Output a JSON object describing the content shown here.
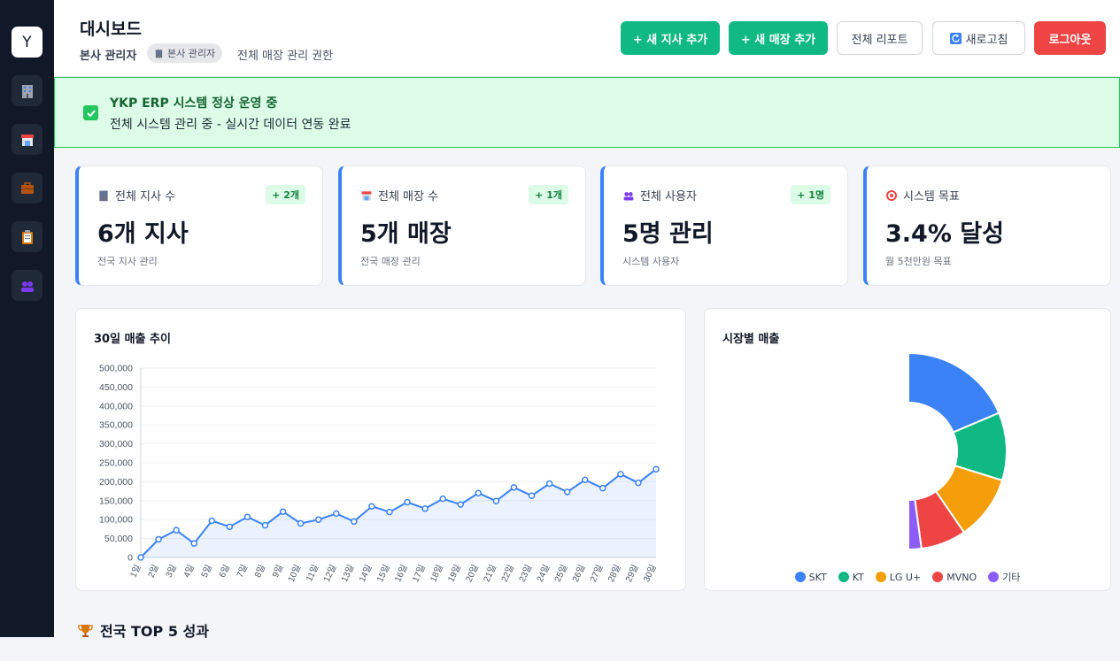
{
  "sidebar": {
    "logo": "Y",
    "items": [
      {
        "icon": "building-icon"
      },
      {
        "icon": "store-icon"
      },
      {
        "icon": "briefcase-icon"
      },
      {
        "icon": "clipboard-icon"
      },
      {
        "icon": "users-icon"
      }
    ]
  },
  "header": {
    "title": "대시보드",
    "role": "본사 관리자",
    "role_badge": "본사 관리자",
    "role_desc": "전체 매장 관리 권한",
    "buttons": {
      "add_branch": "+ 새 지사 추가",
      "add_store": "+ 새 매장 추가",
      "report": "전체 리포트",
      "refresh": "새로고침",
      "logout": "로그아웃"
    }
  },
  "banner": {
    "title": "YKP ERP 시스템 정상 운영 중",
    "subtitle": "전체 시스템 관리 중 - 실시간 데이터 연동 완료"
  },
  "stats": [
    {
      "label": "전체 지사 수",
      "delta": "+ 2개",
      "value": "6개 지사",
      "sub": "전국 지사 관리",
      "icon": "building-icon"
    },
    {
      "label": "전체 매장 수",
      "delta": "+ 1개",
      "value": "5개 매장",
      "sub": "전국 매장 관리",
      "icon": "store-icon"
    },
    {
      "label": "전체 사용자",
      "delta": "+ 1명",
      "value": "5명 관리",
      "sub": "시스템 사용자",
      "icon": "users-icon"
    },
    {
      "label": "시스템 목표",
      "delta": "",
      "value": "3.4% 달성",
      "sub": "월 5천만원 목표",
      "icon": "target-icon"
    }
  ],
  "sales_chart": {
    "title": "30일 매출 추이"
  },
  "market_chart": {
    "title": "시장별 매출"
  },
  "top5": {
    "title": "전국 TOP 5 성과"
  },
  "colors": {
    "accent_green": "#10b981",
    "danger": "#ef4444",
    "stat_border": "#3b82f6",
    "line": "#3b82f6"
  },
  "chart_data": [
    {
      "type": "line",
      "title": "30일 매출 추이",
      "categories": [
        "1일",
        "2일",
        "3일",
        "4일",
        "5일",
        "6일",
        "7일",
        "8일",
        "9일",
        "10일",
        "11일",
        "12일",
        "13일",
        "14일",
        "15일",
        "16일",
        "17일",
        "18일",
        "19일",
        "20일",
        "21일",
        "22일",
        "23일",
        "24일",
        "25일",
        "26일",
        "27일",
        "28일",
        "29일",
        "30일"
      ],
      "series": [
        {
          "values": [
            0,
            48000,
            72000,
            37000,
            97000,
            81000,
            107000,
            85000,
            121000,
            90000,
            100000,
            116000,
            95000,
            135000,
            120000,
            146000,
            129000,
            155000,
            140000,
            170000,
            149000,
            185000,
            163000,
            195000,
            173000,
            205000,
            183000,
            220000,
            197000,
            233000
          ]
        }
      ],
      "ylim": [
        0,
        500000
      ],
      "yticks": [
        "0",
        "50,000",
        "100,000",
        "150,000",
        "200,000",
        "250,000",
        "300,000",
        "350,000",
        "400,000",
        "450,000",
        "500,000"
      ],
      "fill": true,
      "grid": true
    },
    {
      "type": "pie",
      "title": "시장별 매출",
      "labels": [
        "SKT",
        "KT",
        "LG U+",
        "MVNO",
        "기타"
      ],
      "values": [
        35,
        21,
        20,
        14,
        4
      ],
      "colors": [
        "#3b82f6",
        "#10b981",
        "#f59e0b",
        "#ef4444",
        "#8b5cf6"
      ],
      "legend": "bottom"
    }
  ]
}
